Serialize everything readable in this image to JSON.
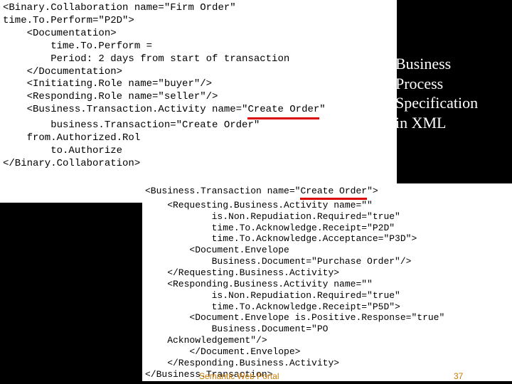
{
  "title": {
    "l1": "Business",
    "l2": "Process",
    "l3": "Specification",
    "l4": "in XML"
  },
  "footer": {
    "label": "Semantic Web Portal",
    "page": "37"
  },
  "outer": {
    "l0": "<Binary.Collaboration name=\"Firm Order\"",
    "l1": "time.To.Perform=\"P2D\">",
    "l2": "    <Documentation>",
    "l3": "        time.To.Perform =",
    "l4": "        Period: 2 days from start of transaction",
    "l5": "    </Documentation>",
    "l6": "    <Initiating.Role name=\"buyer\"/>",
    "l7": "    <Responding.Role name=\"seller\"/>",
    "l8a": "    <Business.Transaction.Activity name=\"",
    "l8u": "Create Order",
    "l8b": "\"",
    "l9": "        business.Transaction=\"Create Order\"",
    "l10": "    from.Authorized.Rol",
    "l11": "        to.Authorize",
    "l12": "</Binary.Collaboration>"
  },
  "inner": {
    "l0a": "<Business.Transaction name=\"",
    "l0u": "Create Order",
    "l0b": "\">",
    "l1": "    <Requesting.Business.Activity name=\"\"",
    "l2": "            is.Non.Repudiation.Required=\"true\"",
    "l3": "            time.To.Acknowledge.Receipt=\"P2D\"",
    "l4": "            time.To.Acknowledge.Acceptance=\"P3D\">",
    "l5": "        <Document.Envelope",
    "l6": "            Business.Document=\"Purchase Order\"/>",
    "l7": "    </Requesting.Business.Activity>",
    "l8": "    <Responding.Business.Activity name=\"\"",
    "l9": "            is.Non.Repudiation.Required=\"true\"",
    "l10": "            time.To.Acknowledge.Receipt=\"P5D\">",
    "l11": "        <Document.Envelope is.Positive.Response=\"true\"",
    "l12": "            Business.Document=\"PO",
    "l13": "    Acknowledgement\"/>",
    "l14": "        </Document.Envelope>",
    "l15": "    </Responding.Business.Activity>",
    "l16": "</Business.Transaction>"
  }
}
